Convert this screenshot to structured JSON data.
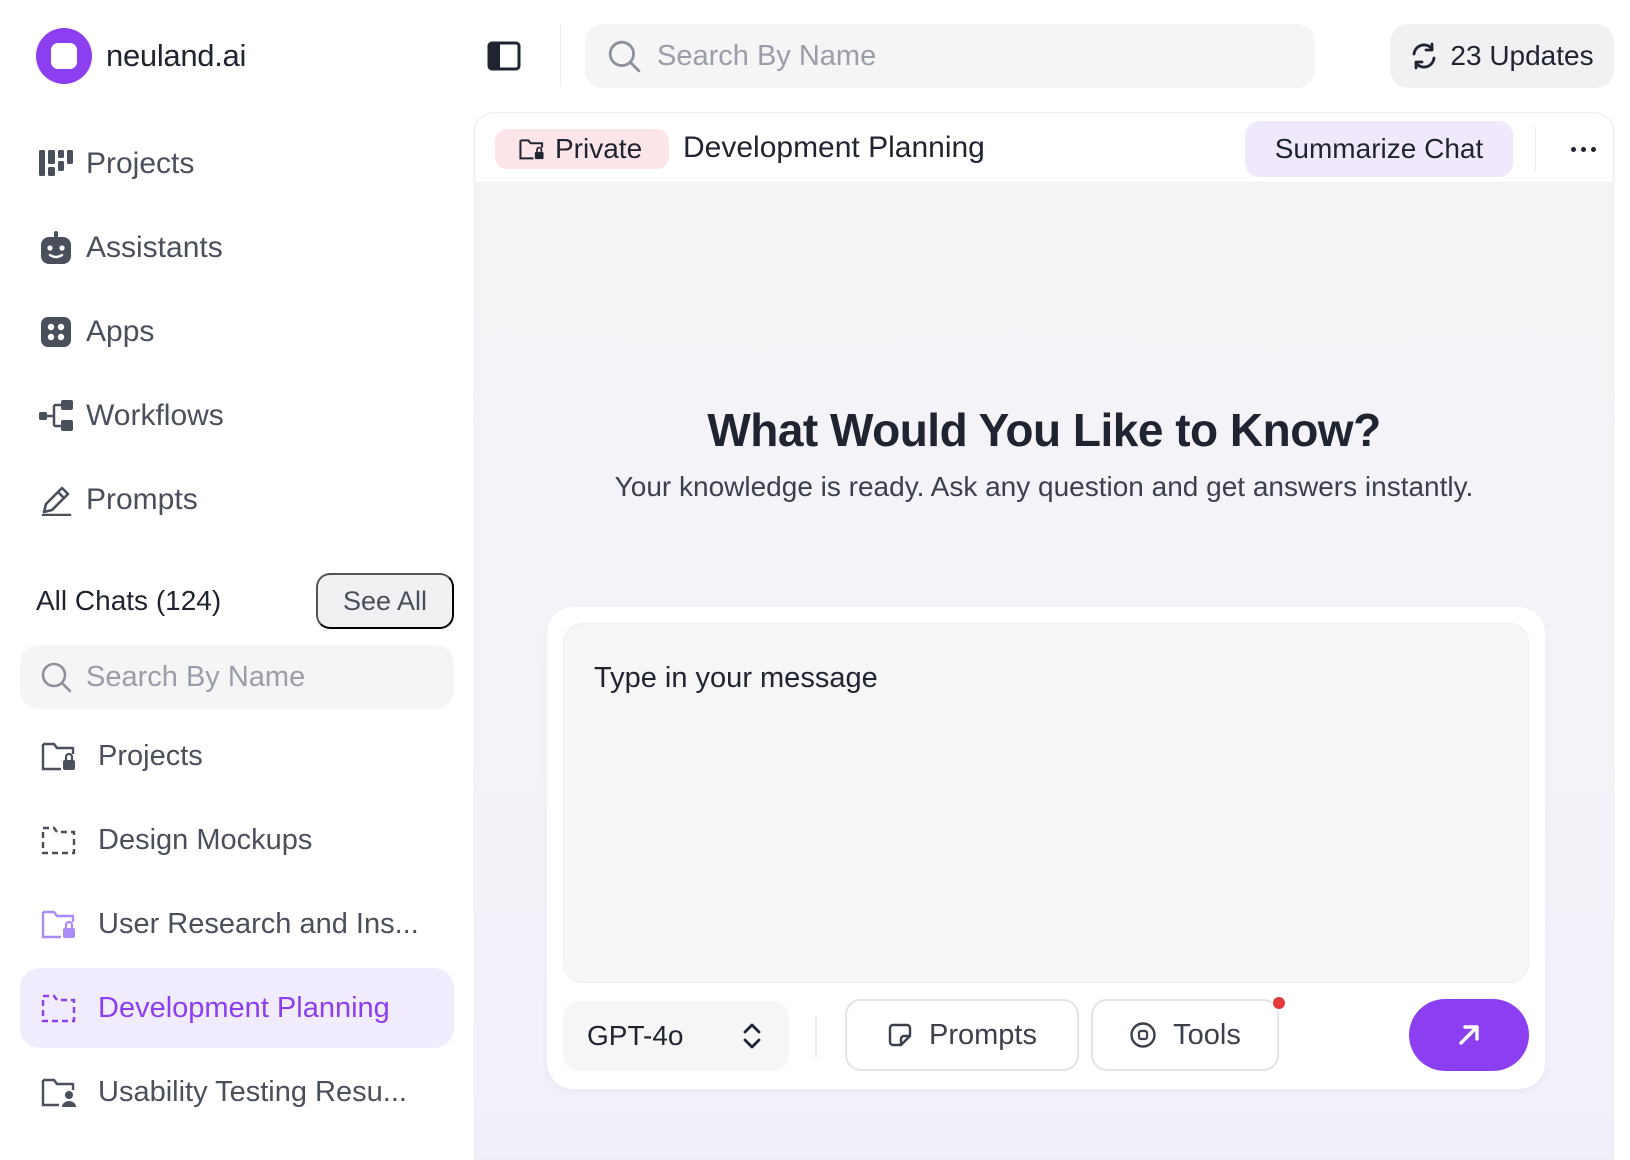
{
  "brand": {
    "name": "neuland.ai",
    "accent": "#8b3ff0"
  },
  "nav": [
    {
      "label": "Projects",
      "icon": "projects-icon"
    },
    {
      "label": "Assistants",
      "icon": "assistant-robot-icon"
    },
    {
      "label": "Apps",
      "icon": "apps-grid-icon"
    },
    {
      "label": "Workflows",
      "icon": "workflow-icon"
    },
    {
      "label": "Prompts",
      "icon": "pencil-icon"
    }
  ],
  "chats": {
    "title": "All Chats (124)",
    "see_all": "See All",
    "search_placeholder": "Search By Name",
    "items": [
      {
        "label": "Projects",
        "icon": "folder-lock-icon",
        "active": false
      },
      {
        "label": "Design Mockups",
        "icon": "folder-dashed-icon",
        "active": false
      },
      {
        "label": "User Research and Ins...",
        "icon": "folder-lock-icon",
        "active": false
      },
      {
        "label": "Development Planning",
        "icon": "folder-dashed-icon",
        "active": true
      },
      {
        "label": "Usability Testing Resu...",
        "icon": "folder-user-icon",
        "active": false
      }
    ]
  },
  "topbar": {
    "search_placeholder": "Search By Name",
    "updates_label": "23 Updates"
  },
  "chat": {
    "privacy_label": "Private",
    "title": "Development Planning",
    "summarize_label": "Summarize Chat",
    "hero_title": "What Would You Like to Know?",
    "hero_subtitle": "Your knowledge is ready. Ask any question and get answers instantly.",
    "message_placeholder": "Type in your message",
    "model": "GPT-4o",
    "prompts_label": "Prompts",
    "tools_label": "Tools"
  }
}
